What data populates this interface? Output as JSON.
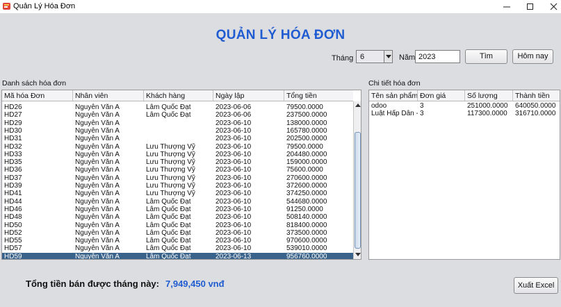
{
  "window": {
    "title": "Quản Lý Hóa Đơn"
  },
  "header": {
    "title": "QUẢN LÝ HÓA ĐƠN"
  },
  "filters": {
    "month_label": "Tháng",
    "month_value": "6",
    "year_label": "Năm",
    "year_value": "2023",
    "search_button": "Tìm",
    "today_button": "Hôm nay"
  },
  "invoices": {
    "section_label": "Danh sách hóa đơn",
    "columns": [
      "Mã hóa Đơn",
      "Nhân viên",
      "Khách hàng",
      "Ngày lập",
      "Tổng tiền"
    ],
    "rows": [
      [
        "HD26",
        "Nguyễn Văn A",
        "Lâm Quốc Đạt",
        "2023-06-06",
        "79500.0000"
      ],
      [
        "HD27",
        "Nguyễn Văn A",
        "Lâm Quốc Đạt",
        "2023-06-06",
        "237500.0000"
      ],
      [
        "HD29",
        "Nguyễn Văn A",
        "",
        "2023-06-10",
        "138000.0000"
      ],
      [
        "HD30",
        "Nguyễn Văn A",
        "",
        "2023-06-10",
        "165780.0000"
      ],
      [
        "HD31",
        "Nguyễn Văn A",
        "",
        "2023-06-10",
        "202500.0000"
      ],
      [
        "HD32",
        "Nguyễn Văn A",
        "Lưu Thượng Vỹ",
        "2023-06-10",
        "79500.0000"
      ],
      [
        "HD33",
        "Nguyễn Văn A",
        "Lưu Thượng Vỹ",
        "2023-06-10",
        "204480.0000"
      ],
      [
        "HD35",
        "Nguyễn Văn A",
        "Lưu Thượng Vỹ",
        "2023-06-10",
        "159000.0000"
      ],
      [
        "HD36",
        "Nguyễn Văn A",
        "Lưu Thượng Vỹ",
        "2023-06-10",
        "75600.0000"
      ],
      [
        "HD37",
        "Nguyễn Văn A",
        "Lưu Thượng Vỹ",
        "2023-06-10",
        "270600.0000"
      ],
      [
        "HD39",
        "Nguyễn Văn A",
        "Lưu Thượng Vỹ",
        "2023-06-10",
        "372600.0000"
      ],
      [
        "HD41",
        "Nguyễn Văn A",
        "Lưu Thượng Vỹ",
        "2023-06-10",
        "374250.0000"
      ],
      [
        "HD44",
        "Nguyễn Văn A",
        "Lâm Quốc Đạt",
        "2023-06-10",
        "544680.0000"
      ],
      [
        "HD46",
        "Nguyễn Văn A",
        "Lâm Quốc Đạt",
        "2023-06-10",
        "91250.0000"
      ],
      [
        "HD48",
        "Nguyễn Văn A",
        "Lâm Quốc Đạt",
        "2023-06-10",
        "508140.0000"
      ],
      [
        "HD50",
        "Nguyễn Văn A",
        "Lâm Quốc Đạt",
        "2023-06-10",
        "818400.0000"
      ],
      [
        "HD52",
        "Nguyễn Văn A",
        "Lâm Quốc Đạt",
        "2023-06-10",
        "373500.0000"
      ],
      [
        "HD55",
        "Nguyễn Văn A",
        "Lâm Quốc Đạt",
        "2023-06-10",
        "970600.0000"
      ],
      [
        "HD57",
        "Nguyễn Văn A",
        "Lâm Quốc Đạt",
        "2023-06-10",
        "539010.0000"
      ],
      [
        "HD59",
        "Nguyễn Văn A",
        "Lâm Quốc Đạt",
        "2023-06-13",
        "956760.0000"
      ]
    ],
    "selected_row": "HD59"
  },
  "details": {
    "section_label": "Chi tiết hóa đơn",
    "columns": [
      "Tên sản phẩm",
      "Đơn giá",
      "Số lượng",
      "Thành tiền"
    ],
    "rows": [
      [
        "odoo",
        "3",
        "251000.0000",
        "640050.0000"
      ],
      [
        "Luật Hấp Dẫn - ...",
        "3",
        "117300.0000",
        "316710.0000"
      ]
    ]
  },
  "footer": {
    "total_label": "Tổng tiền bán được tháng này:",
    "total_value": "7,949,450 vnđ",
    "export_button": "Xuất Excel"
  },
  "colors": {
    "title_blue": "#1f5bd1",
    "selection": "#3a638b",
    "background": "#dcdde1"
  }
}
